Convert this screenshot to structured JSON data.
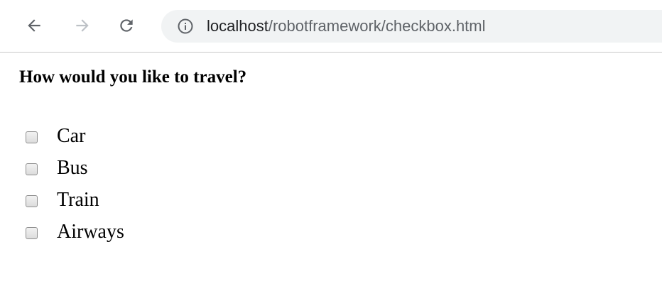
{
  "browser": {
    "url_host": "localhost",
    "url_path": "/robotframework/checkbox.html",
    "icons": {
      "back": "arrow-left-icon",
      "forward": "arrow-right-icon",
      "reload": "reload-icon",
      "info": "info-icon"
    }
  },
  "page": {
    "heading": "How would you like to travel?",
    "options": [
      {
        "label": "Car",
        "checked": false
      },
      {
        "label": "Bus",
        "checked": false
      },
      {
        "label": "Train",
        "checked": false
      },
      {
        "label": "Airways",
        "checked": false
      }
    ]
  }
}
